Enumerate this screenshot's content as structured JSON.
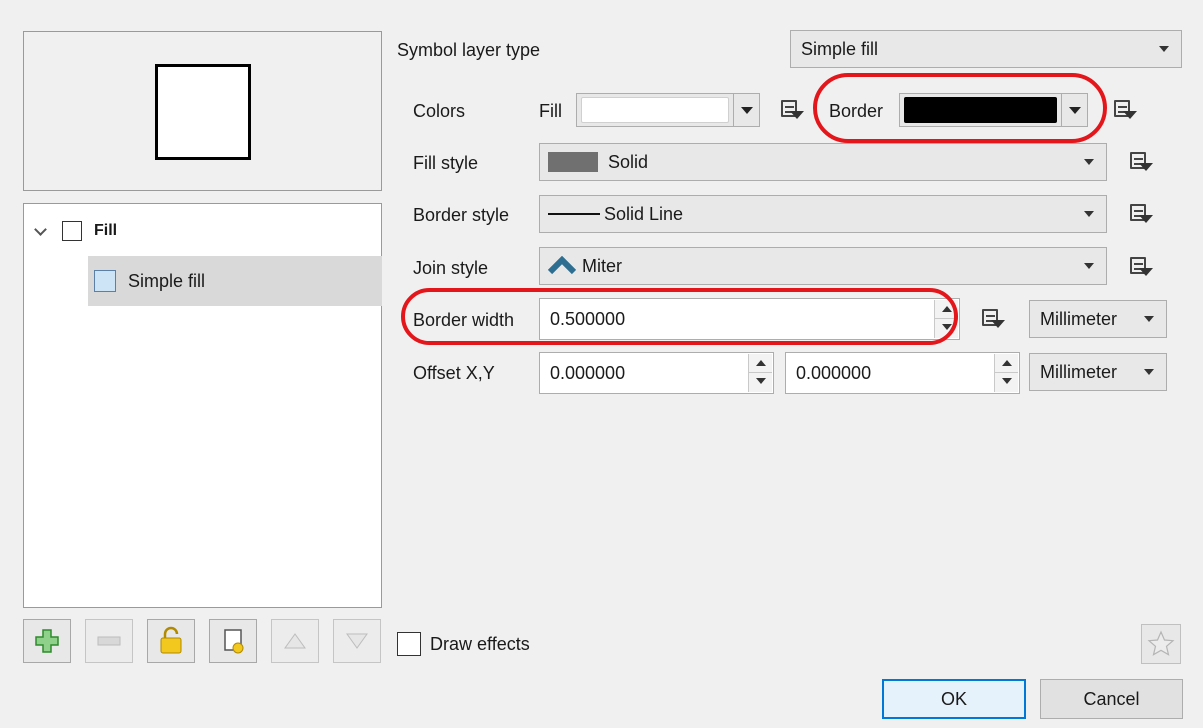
{
  "tree": {
    "root_label": "Fill",
    "child_label": "Simple fill"
  },
  "form": {
    "symbol_layer_type_label": "Symbol layer type",
    "symbol_layer_type_value": "Simple fill",
    "colors_label": "Colors",
    "fill_label": "Fill",
    "fill_color": "#ffffff",
    "border_label": "Border",
    "border_color": "#000000",
    "fill_style_label": "Fill style",
    "fill_style_value": "Solid",
    "border_style_label": "Border style",
    "border_style_value": "Solid Line",
    "join_style_label": "Join style",
    "join_style_value": "Miter",
    "border_width_label": "Border width",
    "border_width_value": "0.500000",
    "border_width_unit": "Millimeter",
    "offset_label": "Offset X,Y",
    "offset_x": "0.000000",
    "offset_y": "0.000000",
    "offset_unit": "Millimeter"
  },
  "footer": {
    "draw_effects_label": "Draw effects",
    "ok_label": "OK",
    "cancel_label": "Cancel"
  },
  "colors": {
    "highlight_ring": "#e3161b",
    "selection_bg": "#d9d9d9",
    "default_button_border": "#0078d7"
  }
}
